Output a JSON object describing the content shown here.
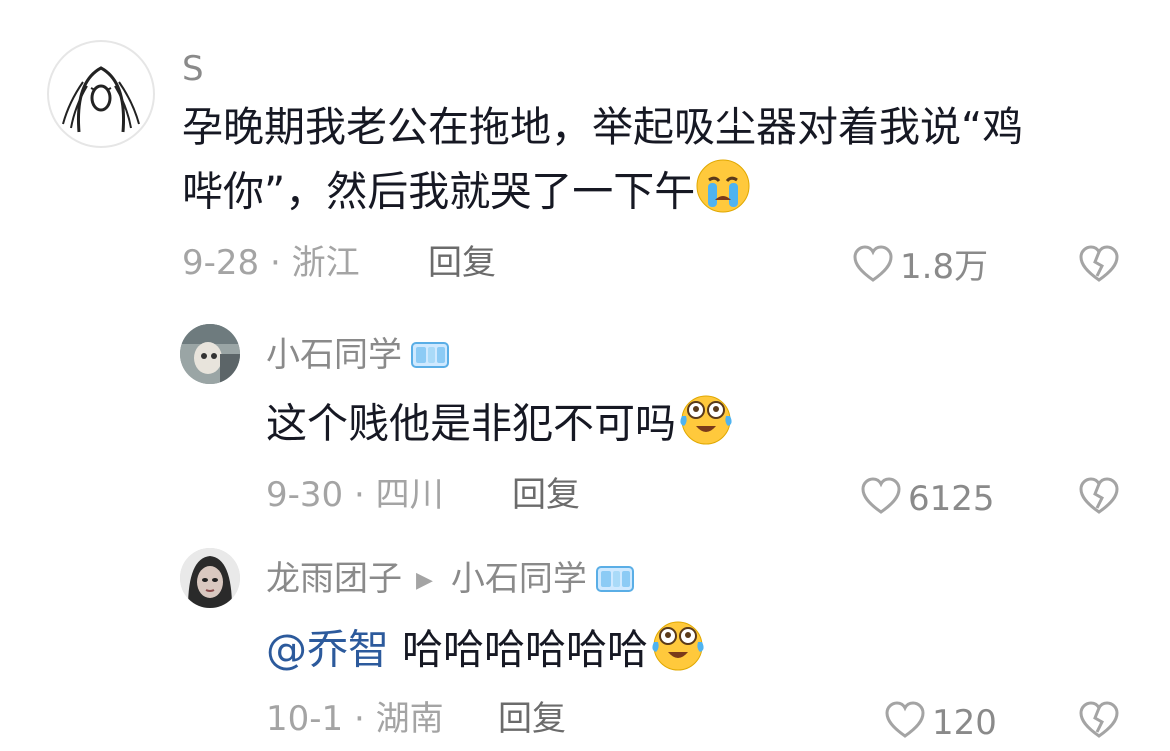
{
  "comments": [
    {
      "username": "S",
      "text_line1": "孕晚期我老公在拖地，举起吸尘器对着我说“鸡",
      "text_line2": "哔你”，然后我就哭了一下午",
      "emoji": "crying-emoji",
      "date": "9-28",
      "location": "浙江",
      "reply_label": "回复",
      "likes": "1.8万"
    },
    {
      "username": "小石同学",
      "badge": "ice-cube-badge",
      "text": "这个贱他是非犯不可吗",
      "emoji": "laugh-cry-emoji",
      "date": "9-30",
      "location": "四川",
      "reply_label": "回复",
      "likes": "6125"
    },
    {
      "username": "龙雨团子",
      "reply_to": "小石同学",
      "badge": "ice-cube-badge",
      "mention": "@乔智",
      "text": "哈哈哈哈哈哈",
      "emoji": "laugh-cry-emoji",
      "date": "10-1",
      "location": "湖南",
      "reply_label": "回复",
      "likes": "120"
    }
  ],
  "colors": {
    "text": "#161823",
    "muted": "#a4a4a4",
    "mention": "#2c5a9c"
  }
}
